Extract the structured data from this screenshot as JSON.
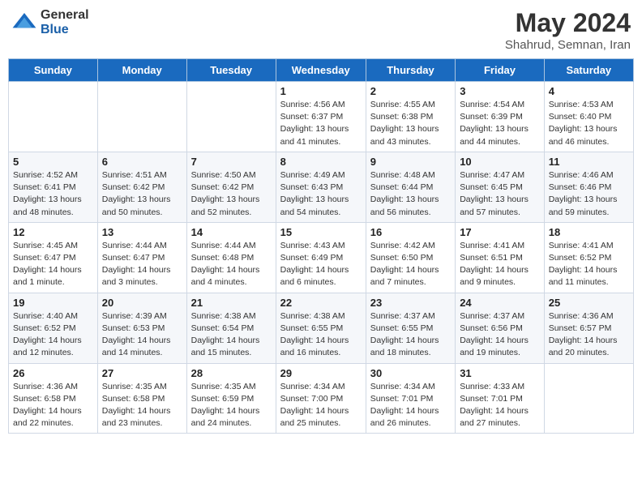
{
  "logo": {
    "general": "General",
    "blue": "Blue"
  },
  "header": {
    "month_year": "May 2024",
    "location": "Shahrud, Semnan, Iran"
  },
  "days_of_week": [
    "Sunday",
    "Monday",
    "Tuesday",
    "Wednesday",
    "Thursday",
    "Friday",
    "Saturday"
  ],
  "weeks": [
    [
      {
        "day": "",
        "info": ""
      },
      {
        "day": "",
        "info": ""
      },
      {
        "day": "",
        "info": ""
      },
      {
        "day": "1",
        "info": "Sunrise: 4:56 AM\nSunset: 6:37 PM\nDaylight: 13 hours\nand 41 minutes."
      },
      {
        "day": "2",
        "info": "Sunrise: 4:55 AM\nSunset: 6:38 PM\nDaylight: 13 hours\nand 43 minutes."
      },
      {
        "day": "3",
        "info": "Sunrise: 4:54 AM\nSunset: 6:39 PM\nDaylight: 13 hours\nand 44 minutes."
      },
      {
        "day": "4",
        "info": "Sunrise: 4:53 AM\nSunset: 6:40 PM\nDaylight: 13 hours\nand 46 minutes."
      }
    ],
    [
      {
        "day": "5",
        "info": "Sunrise: 4:52 AM\nSunset: 6:41 PM\nDaylight: 13 hours\nand 48 minutes."
      },
      {
        "day": "6",
        "info": "Sunrise: 4:51 AM\nSunset: 6:42 PM\nDaylight: 13 hours\nand 50 minutes."
      },
      {
        "day": "7",
        "info": "Sunrise: 4:50 AM\nSunset: 6:42 PM\nDaylight: 13 hours\nand 52 minutes."
      },
      {
        "day": "8",
        "info": "Sunrise: 4:49 AM\nSunset: 6:43 PM\nDaylight: 13 hours\nand 54 minutes."
      },
      {
        "day": "9",
        "info": "Sunrise: 4:48 AM\nSunset: 6:44 PM\nDaylight: 13 hours\nand 56 minutes."
      },
      {
        "day": "10",
        "info": "Sunrise: 4:47 AM\nSunset: 6:45 PM\nDaylight: 13 hours\nand 57 minutes."
      },
      {
        "day": "11",
        "info": "Sunrise: 4:46 AM\nSunset: 6:46 PM\nDaylight: 13 hours\nand 59 minutes."
      }
    ],
    [
      {
        "day": "12",
        "info": "Sunrise: 4:45 AM\nSunset: 6:47 PM\nDaylight: 14 hours\nand 1 minute."
      },
      {
        "day": "13",
        "info": "Sunrise: 4:44 AM\nSunset: 6:47 PM\nDaylight: 14 hours\nand 3 minutes."
      },
      {
        "day": "14",
        "info": "Sunrise: 4:44 AM\nSunset: 6:48 PM\nDaylight: 14 hours\nand 4 minutes."
      },
      {
        "day": "15",
        "info": "Sunrise: 4:43 AM\nSunset: 6:49 PM\nDaylight: 14 hours\nand 6 minutes."
      },
      {
        "day": "16",
        "info": "Sunrise: 4:42 AM\nSunset: 6:50 PM\nDaylight: 14 hours\nand 7 minutes."
      },
      {
        "day": "17",
        "info": "Sunrise: 4:41 AM\nSunset: 6:51 PM\nDaylight: 14 hours\nand 9 minutes."
      },
      {
        "day": "18",
        "info": "Sunrise: 4:41 AM\nSunset: 6:52 PM\nDaylight: 14 hours\nand 11 minutes."
      }
    ],
    [
      {
        "day": "19",
        "info": "Sunrise: 4:40 AM\nSunset: 6:52 PM\nDaylight: 14 hours\nand 12 minutes."
      },
      {
        "day": "20",
        "info": "Sunrise: 4:39 AM\nSunset: 6:53 PM\nDaylight: 14 hours\nand 14 minutes."
      },
      {
        "day": "21",
        "info": "Sunrise: 4:38 AM\nSunset: 6:54 PM\nDaylight: 14 hours\nand 15 minutes."
      },
      {
        "day": "22",
        "info": "Sunrise: 4:38 AM\nSunset: 6:55 PM\nDaylight: 14 hours\nand 16 minutes."
      },
      {
        "day": "23",
        "info": "Sunrise: 4:37 AM\nSunset: 6:55 PM\nDaylight: 14 hours\nand 18 minutes."
      },
      {
        "day": "24",
        "info": "Sunrise: 4:37 AM\nSunset: 6:56 PM\nDaylight: 14 hours\nand 19 minutes."
      },
      {
        "day": "25",
        "info": "Sunrise: 4:36 AM\nSunset: 6:57 PM\nDaylight: 14 hours\nand 20 minutes."
      }
    ],
    [
      {
        "day": "26",
        "info": "Sunrise: 4:36 AM\nSunset: 6:58 PM\nDaylight: 14 hours\nand 22 minutes."
      },
      {
        "day": "27",
        "info": "Sunrise: 4:35 AM\nSunset: 6:58 PM\nDaylight: 14 hours\nand 23 minutes."
      },
      {
        "day": "28",
        "info": "Sunrise: 4:35 AM\nSunset: 6:59 PM\nDaylight: 14 hours\nand 24 minutes."
      },
      {
        "day": "29",
        "info": "Sunrise: 4:34 AM\nSunset: 7:00 PM\nDaylight: 14 hours\nand 25 minutes."
      },
      {
        "day": "30",
        "info": "Sunrise: 4:34 AM\nSunset: 7:01 PM\nDaylight: 14 hours\nand 26 minutes."
      },
      {
        "day": "31",
        "info": "Sunrise: 4:33 AM\nSunset: 7:01 PM\nDaylight: 14 hours\nand 27 minutes."
      },
      {
        "day": "",
        "info": ""
      }
    ]
  ]
}
